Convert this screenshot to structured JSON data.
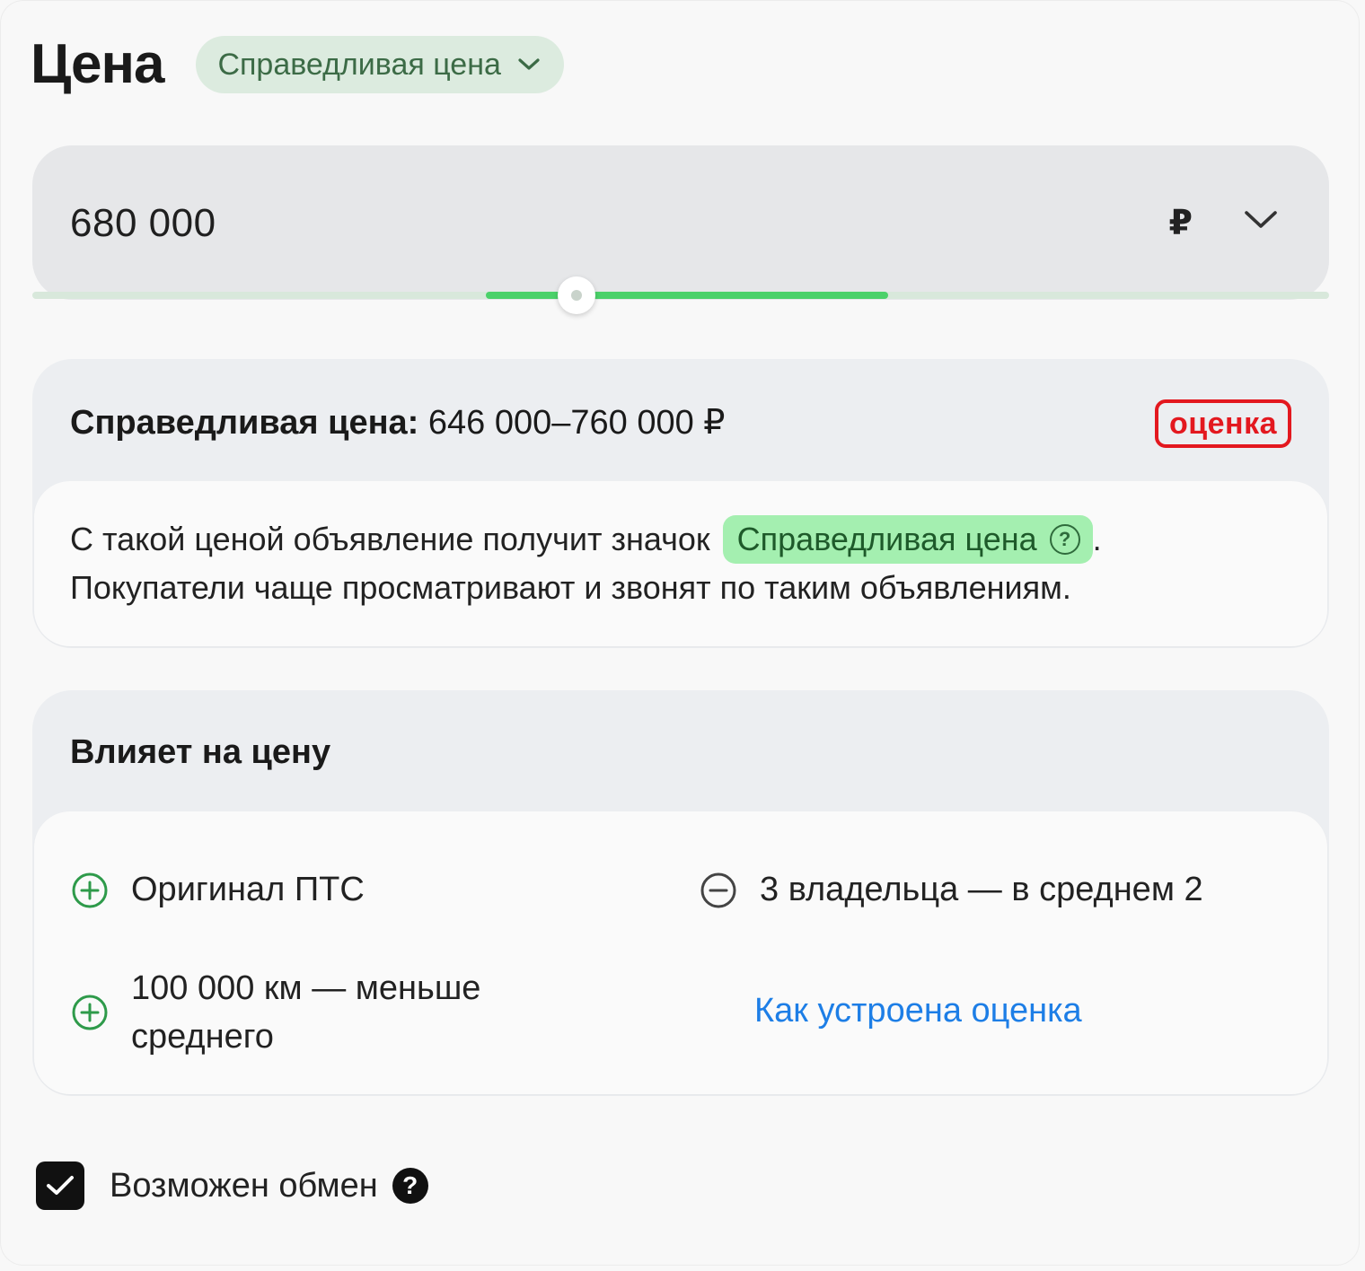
{
  "header": {
    "title": "Цена",
    "badge_label": "Справедливая цена"
  },
  "price_field": {
    "value": "680 000",
    "currency": "₽"
  },
  "slider": {
    "fair_range_fraction": [
      0.35,
      0.66
    ],
    "value_fraction": 0.42
  },
  "fair_card": {
    "title_label": "Справедливая цена:",
    "title_range": "646 000–760 000 ₽",
    "ocenka_logo": "оценка",
    "text_before": "С такой ценой объявление получит значок",
    "chip_label": "Справедливая цена",
    "chip_help": "?",
    "text_period": ".",
    "text_line2": "Покупатели чаще просматривают и звонят по таким объявлениям."
  },
  "affects_card": {
    "title": "Влияет на цену",
    "factors": [
      {
        "label": "Оригинал ПТС",
        "effect": "plus"
      },
      {
        "label": "3 владельца — в среднем 2",
        "effect": "minus"
      },
      {
        "label_line1": "100 000 км — меньше",
        "label_line2": "среднего",
        "effect": "plus"
      }
    ],
    "link": "Как устроена оценка"
  },
  "exchange": {
    "label": "Возможен обмен",
    "checked": true,
    "help": "?"
  },
  "colors": {
    "accent_green": "#4bd16a",
    "chip_green": "#a4efb0",
    "plus_icon": "#2e9a4a",
    "link_blue": "#1d7ee6",
    "brand_red": "#e3181f"
  }
}
